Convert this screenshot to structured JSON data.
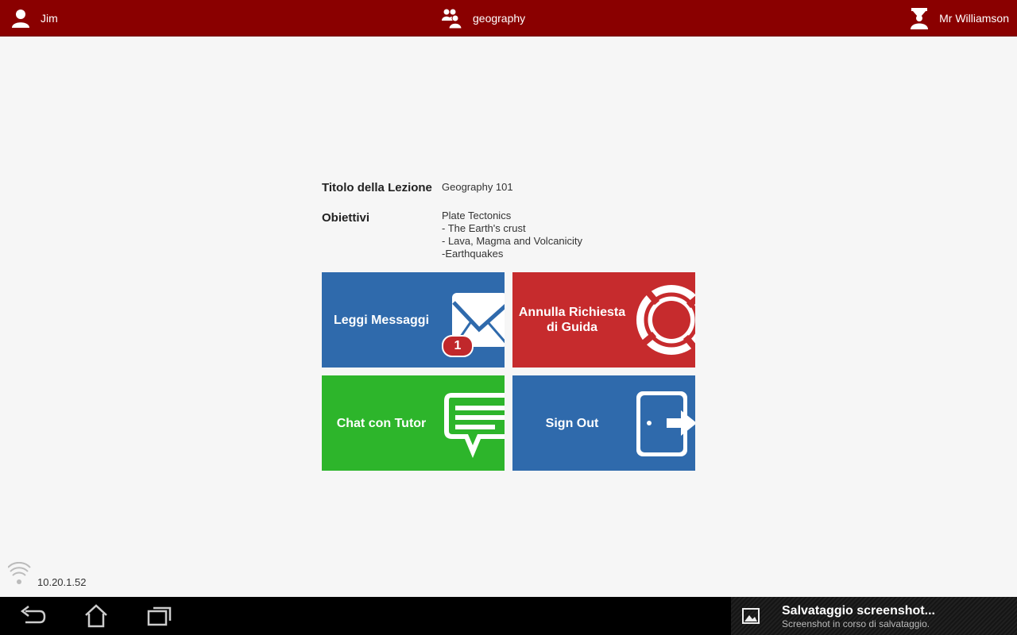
{
  "topbar": {
    "student_name": "Jim",
    "class_name": "geography",
    "tutor_name": "Mr Williamson"
  },
  "lesson": {
    "title_label": "Titolo della Lezione",
    "title_value": "Geography 101",
    "objectives_label": "Obiettivi",
    "objectives": [
      "Plate Tectonics",
      "- The Earth's crust",
      "- Lava, Magma and Volcanicity",
      "-Earthquakes"
    ]
  },
  "tiles": {
    "messages": {
      "label": "Leggi Messaggi",
      "badge": "1",
      "color": "#2f6aac"
    },
    "help": {
      "label": "Annulla Richiesta di Guida",
      "color": "#c62b2d"
    },
    "chat": {
      "label": "Chat con Tutor",
      "color": "#2db52b"
    },
    "signout": {
      "label": "Sign Out",
      "color": "#2f6aac"
    }
  },
  "status": {
    "ip": "10.20.1.52"
  },
  "notification": {
    "title": "Salvataggio screenshot...",
    "subtitle": "Screenshot in corso di salvataggio."
  },
  "icons": [
    "user-icon",
    "group-icon",
    "tutor-icon",
    "envelope-icon",
    "lifebuoy-icon",
    "chat-bubble-icon",
    "door-exit-icon",
    "wifi-icon",
    "back-icon",
    "home-icon",
    "recent-apps-icon",
    "image-icon"
  ],
  "colors": {
    "topbar": "#8a0000",
    "page_bg": "#f6f6f6"
  }
}
